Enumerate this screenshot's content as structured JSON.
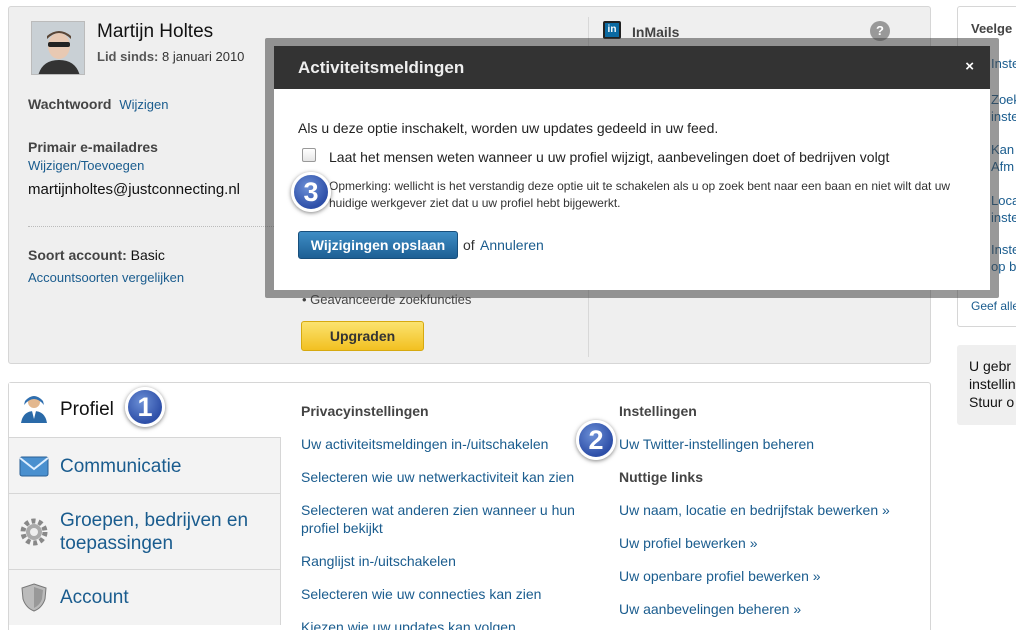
{
  "profile_card": {
    "name": "Martijn Holtes",
    "member_since_label": "Lid sinds:",
    "member_since_value": "8 januari 2010",
    "password_label": "Wachtwoord",
    "password_change": "Wijzigen",
    "email_label": "Primair e-mailadres",
    "email_change": "Wijzigen/Toevoegen",
    "email_value": "martijnholtes@justconnecting.nl",
    "account_type_label": "Soort account:",
    "account_type_value": "Basic",
    "compare_link": "Accountsoorten vergelijken",
    "feature_item": "Geavanceerde zoekfuncties",
    "upgrade_button": "Upgraden",
    "inmails_icon": "in",
    "inmails_title": "InMails",
    "help_icon": "?"
  },
  "right_sidebar": {
    "title": "Veelge",
    "items": [
      {
        "lines": [
          "Inste"
        ]
      },
      {
        "lines": [
          "Zoek",
          "inste"
        ]
      },
      {
        "lines": [
          "Kan",
          "Afm"
        ]
      },
      {
        "lines": [
          "Loca",
          "inste"
        ]
      },
      {
        "lines": [
          "Inste",
          "op b"
        ]
      }
    ],
    "footer": "Geef alle",
    "box2_lines": [
      "U gebr",
      "instellin",
      "Stuur o"
    ]
  },
  "settings_card": {
    "tabs": [
      {
        "label_lines": [
          "Profiel"
        ]
      },
      {
        "label_lines": [
          "Communicatie"
        ]
      },
      {
        "label_lines": [
          "Groepen, bedrijven en",
          "toepassingen"
        ]
      },
      {
        "label_lines": [
          "Account"
        ]
      }
    ],
    "privacy_title": "Privacyinstellingen",
    "privacy_links": [
      "Uw activiteitsmeldingen in-/uitschakelen",
      "Selecteren wie uw netwerkactiviteit kan zien",
      "Selecteren wat anderen zien wanneer u hun profiel bekijkt",
      "Ranglijst in-/uitschakelen",
      "Selecteren wie uw connecties kan zien",
      "Kiezen wie uw updates kan volgen"
    ],
    "settings_title": "Instellingen",
    "settings_links": [
      "Uw Twitter-instellingen beheren"
    ],
    "useful_title": "Nuttige links",
    "useful_links": [
      "Uw naam, locatie en bedrijfstak bewerken »",
      "Uw profiel bewerken »",
      "Uw openbare profiel bewerken »",
      "Uw aanbevelingen beheren »"
    ]
  },
  "modal": {
    "title": "Activiteitsmeldingen",
    "close": "×",
    "intro": "Als u deze optie inschakelt, worden uw updates gedeeld in uw feed.",
    "checkbox_label": "Laat het mensen weten wanneer u uw profiel wijzigt, aanbevelingen doet of bedrijven volgt",
    "checkbox_checked": false,
    "note": "Opmerking: wellicht is het verstandig deze optie uit te schakelen als u op zoek bent naar een baan en niet wilt dat uw huidige werkgever ziet dat u uw profiel hebt bijgewerkt.",
    "save_button": "Wijzigingen opslaan",
    "or_text": "of",
    "cancel_link": "Annuleren"
  },
  "badges": [
    "1",
    "2",
    "3"
  ],
  "colors": {
    "link": "#1a5c8e",
    "modal_header": "#333333",
    "save_button": "#2a78b3",
    "upgrade_button": "#f5cb2e",
    "badge": "#3a5cb8"
  }
}
